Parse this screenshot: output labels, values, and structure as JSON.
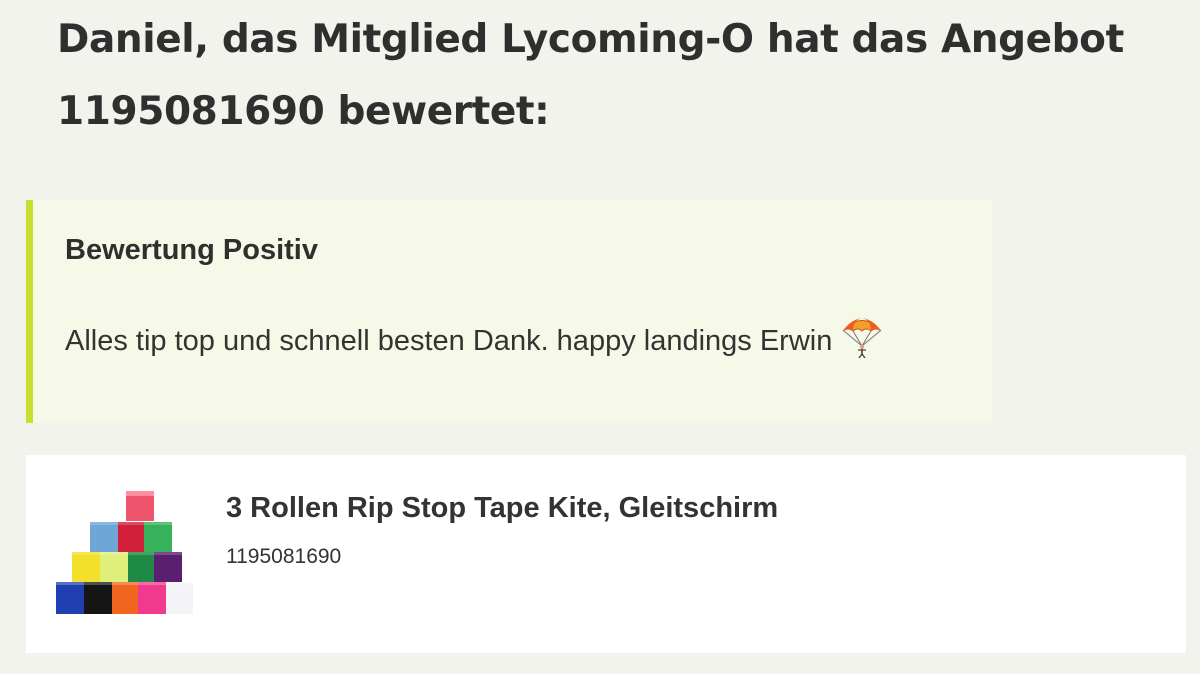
{
  "notification": {
    "heading": "Daniel, das Mitglied Lycoming-O hat das Angebot 1195081690 bewertet:"
  },
  "review": {
    "title": "Bewertung Positiv",
    "text": "Alles tip top und schnell besten Dank. happy landings Erwin",
    "emoji_icon": "parachute-icon",
    "accent_color": "#c9df2f",
    "background_color": "#f6f9e8"
  },
  "product": {
    "title": "3 Rollen Rip Stop Tape Kite, Gleitschirm",
    "id": "1195081690",
    "image_icon": "tape-rolls-image"
  },
  "colors": {
    "page_background": "#f3f3ee",
    "card_background": "#ffffff",
    "text": "#2f2f2f"
  }
}
